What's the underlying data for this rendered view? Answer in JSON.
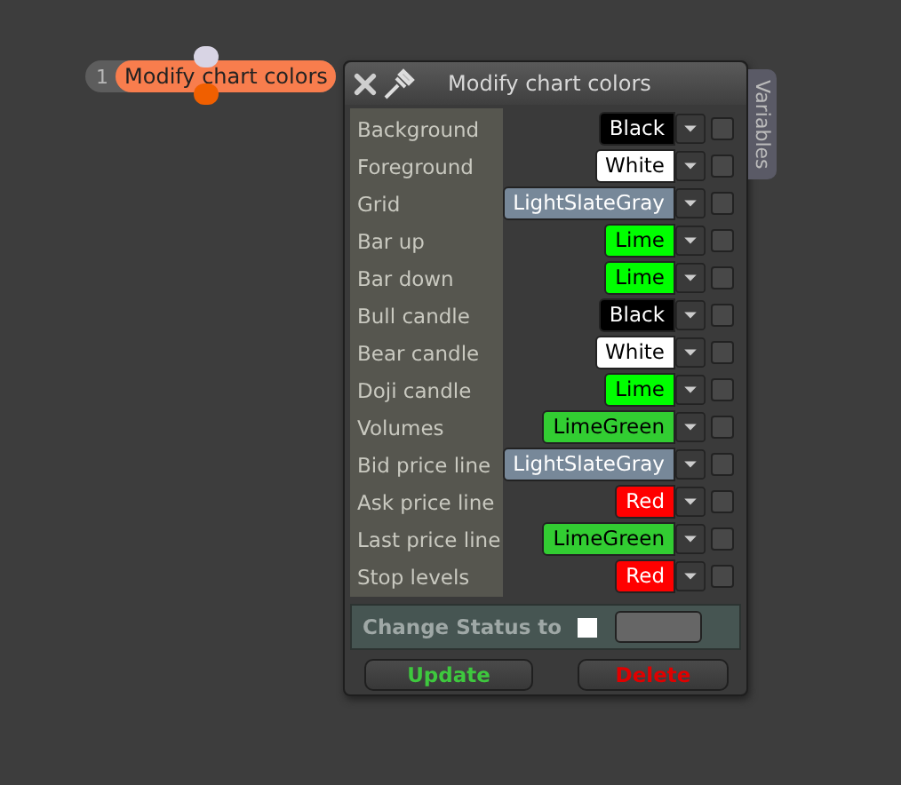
{
  "node": {
    "index": "1",
    "label": "Modify chart colors"
  },
  "dialog": {
    "title": "Modify chart colors",
    "side_tab": "Variables",
    "rows": [
      {
        "label": "Background",
        "value": "Black",
        "color": "#000000",
        "checked": false
      },
      {
        "label": "Foreground",
        "value": "White",
        "color": "#ffffff",
        "checked": false
      },
      {
        "label": "Grid",
        "value": "LightSlateGray",
        "color": "#778899",
        "checked": false
      },
      {
        "label": "Bar up",
        "value": "Lime",
        "color": "#00ff00",
        "checked": false
      },
      {
        "label": "Bar down",
        "value": "Lime",
        "color": "#00ff00",
        "checked": false
      },
      {
        "label": "Bull candle",
        "value": "Black",
        "color": "#000000",
        "checked": false
      },
      {
        "label": "Bear candle",
        "value": "White",
        "color": "#ffffff",
        "checked": false
      },
      {
        "label": "Doji candle",
        "value": "Lime",
        "color": "#00ff00",
        "checked": false
      },
      {
        "label": "Volumes",
        "value": "LimeGreen",
        "color": "#32cd32",
        "checked": false
      },
      {
        "label": "Bid price line",
        "value": "LightSlateGray",
        "color": "#778899",
        "checked": false
      },
      {
        "label": "Ask price line",
        "value": "Red",
        "color": "#ff0000",
        "checked": false
      },
      {
        "label": "Last price line",
        "value": "LimeGreen",
        "color": "#32cd32",
        "checked": false
      },
      {
        "label": "Stop levels",
        "value": "Red",
        "color": "#ff0000",
        "checked": false
      }
    ],
    "status_label": "Change Status to",
    "status_checkbox": {
      "checked": false
    },
    "buttons": [
      {
        "label": "Update",
        "kind": "update"
      },
      {
        "label": "Delete",
        "kind": "delete"
      }
    ]
  }
}
